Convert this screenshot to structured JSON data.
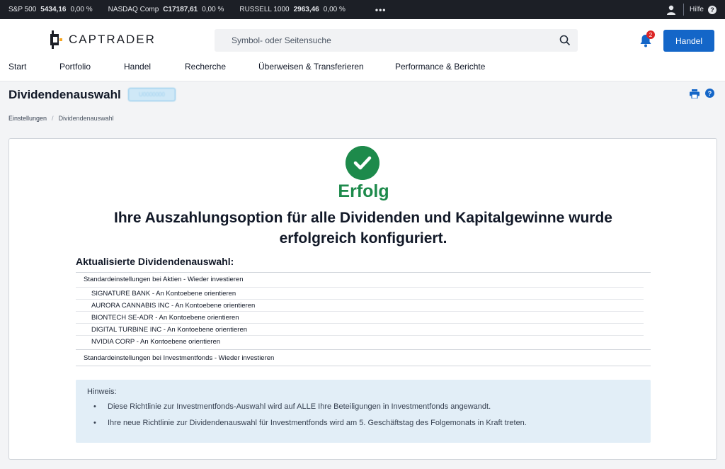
{
  "ticker": {
    "items": [
      {
        "name": "S&P 500",
        "value": "5434,16",
        "change": "0,00 %"
      },
      {
        "name": "NASDAQ Comp",
        "value": "C17187,61",
        "change": "0,00 %"
      },
      {
        "name": "RUSSELL 1000",
        "value": "2963,46",
        "change": "0,00 %"
      }
    ],
    "more": "•••",
    "help_label": "Hilfe",
    "help_icon": "?"
  },
  "header": {
    "logo_text": "CAPTRADER",
    "search_placeholder": "Symbol- oder Seitensuche",
    "notification_count": "2",
    "trade_button": "Handel"
  },
  "nav": [
    "Start",
    "Portfolio",
    "Handel",
    "Recherche",
    "Überweisen & Transferieren",
    "Performance & Berichte"
  ],
  "page": {
    "title": "Dividendenauswahl",
    "account_badge": "U0000000",
    "help_icon": "?",
    "breadcrumb": [
      "Einstellungen",
      "Dividendenauswahl"
    ],
    "breadcrumb_sep": "/"
  },
  "result": {
    "status": "Erfolg",
    "message": "Ihre Auszahlungsoption für alle Dividenden und Kapitalgewinne wurde erfolgreich konfiguriert.",
    "section_title": "Aktualisierte Dividendenauswahl:",
    "stock_default": "Standardeinstellungen bei Aktien - Wieder investieren",
    "stock_items": [
      "SIGNATURE BANK - An Kontoebene orientieren",
      "AURORA CANNABIS INC - An Kontoebene orientieren",
      "BIONTECH SE-ADR - An Kontoebene orientieren",
      "DIGITAL TURBINE INC - An Kontoebene orientieren",
      "NVIDIA CORP - An Kontoebene orientieren"
    ],
    "fund_default": "Standardeinstellungen bei Investmentfonds - Wieder investieren"
  },
  "note": {
    "title": "Hinweis:",
    "items": [
      "Diese Richtlinie zur Investmentfonds-Auswahl wird auf ALLE Ihre Beteiligungen in Investmentfonds angewandt.",
      "Ihre neue Richtlinie zur Dividendenauswahl für Investmentfonds wird am 5. Geschäftstag des Folgemonats in Kraft treten."
    ],
    "bullet": "•"
  },
  "colors": {
    "success": "#1d8a4b",
    "primary": "#1466c8",
    "ticker_bg": "#1c1f26",
    "note_bg": "#e2eef7",
    "badge": "#dc2626"
  }
}
